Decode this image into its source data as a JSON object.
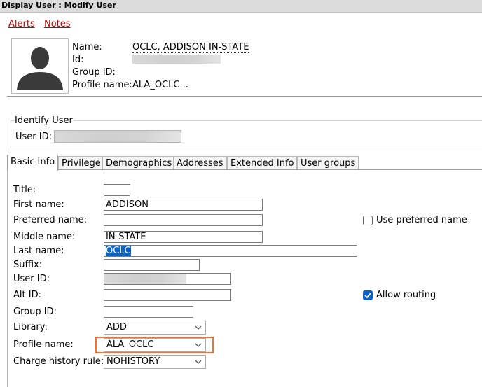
{
  "window": {
    "title": "Display User : Modify User"
  },
  "links": {
    "alerts": "Alerts",
    "notes": "Notes"
  },
  "icons": {
    "photo": "user-silhouette-icon",
    "chevron": "chevron-down-icon",
    "check": "checkmark-icon"
  },
  "summary": {
    "name_label": "Name:",
    "name_value": "OCLC, ADDISON IN-STATE",
    "id_label": "Id:",
    "group_label": "Group ID:",
    "profile_label": "Profile name:",
    "profile_value": "ALA_OCLC..."
  },
  "identify": {
    "legend": "Identify User",
    "user_id_label": "User ID:"
  },
  "tabs": [
    "Basic Info",
    "Privilege",
    "Demographics",
    "Addresses",
    "Extended Info",
    "User groups"
  ],
  "active_tab": "Basic Info",
  "form": {
    "title": {
      "label": "Title:",
      "value": ""
    },
    "first_name": {
      "label": "First name:",
      "value": "ADDISON"
    },
    "preferred_name": {
      "label": "Preferred name:",
      "value": ""
    },
    "middle_name": {
      "label": "Middle name:",
      "value": "IN-STATE"
    },
    "last_name": {
      "label": "Last name:",
      "value": "OCLC"
    },
    "suffix": {
      "label": "Suffix:",
      "value": ""
    },
    "user_id": {
      "label": "User ID:"
    },
    "alt_id": {
      "label": "Alt ID:",
      "value": ""
    },
    "group_id": {
      "label": "Group ID:",
      "value": ""
    },
    "library": {
      "label": "Library:",
      "value": "ADD"
    },
    "profile_name": {
      "label": "Profile name:",
      "value": "ALA_OCLC"
    },
    "charge_history_rule": {
      "label": "Charge history rule:",
      "value": "NOHISTORY"
    },
    "use_preferred_name": {
      "label": "Use preferred name",
      "checked": false
    },
    "allow_routing": {
      "label": "Allow routing",
      "checked": true
    }
  },
  "colors": {
    "link": "#c00000",
    "highlight_box": "#f07038",
    "checkbox_checked": "#0b5fc4",
    "selection": "#0a64c8"
  }
}
